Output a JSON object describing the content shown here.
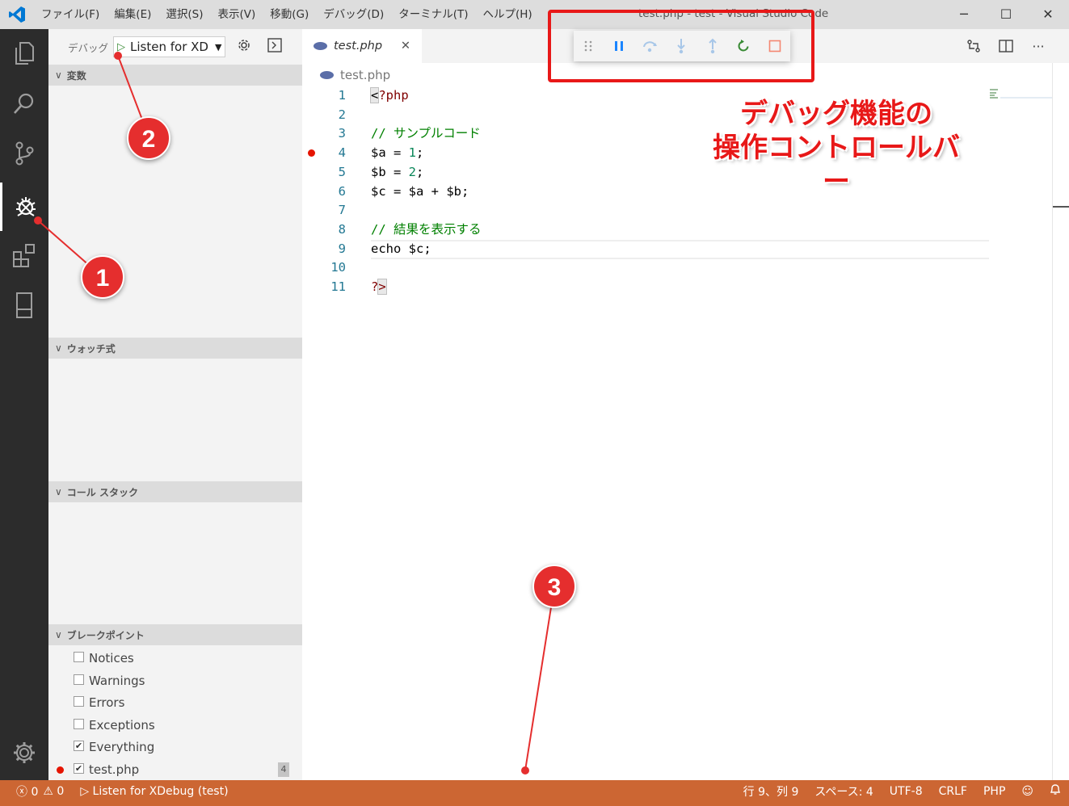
{
  "titlebar": {
    "menu": [
      "ファイル(F)",
      "編集(E)",
      "選択(S)",
      "表示(V)",
      "移動(G)",
      "デバッグ(D)",
      "ターミナル(T)",
      "ヘルプ(H)"
    ],
    "title": "test.php - test - Visual Studio Code",
    "controls": {
      "minimize": "─",
      "maximize": "☐",
      "close": "✕"
    }
  },
  "activity": {
    "items": [
      "explorer-icon",
      "search-icon",
      "source-control-icon",
      "debug-icon",
      "extensions-icon",
      "remote-icon"
    ],
    "active": "debug-icon",
    "settings": "gear-icon"
  },
  "sidebar": {
    "debug_label": "デバッグ",
    "config_name": "Listen for XD",
    "sections": {
      "variables": "変数",
      "watch": "ウォッチ式",
      "callstack": "コール スタック",
      "breakpoints": "ブレークポイント"
    },
    "breakpoints": [
      {
        "label": "Notices",
        "checked": false
      },
      {
        "label": "Warnings",
        "checked": false
      },
      {
        "label": "Errors",
        "checked": false
      },
      {
        "label": "Exceptions",
        "checked": false
      },
      {
        "label": "Everything",
        "checked": true
      },
      {
        "label": "test.php",
        "checked": true,
        "line": "4"
      }
    ]
  },
  "editor": {
    "tab_label": "test.php",
    "breadcrumb": "test.php",
    "lines": [
      {
        "n": "1",
        "text": "<?php"
      },
      {
        "n": "2",
        "text": ""
      },
      {
        "n": "3",
        "text": "// サンプルコード"
      },
      {
        "n": "4",
        "text": "$a = 1;"
      },
      {
        "n": "5",
        "text": "$b = 2;"
      },
      {
        "n": "6",
        "text": "$c = $a + $b;"
      },
      {
        "n": "7",
        "text": ""
      },
      {
        "n": "8",
        "text": "// 結果を表示する"
      },
      {
        "n": "9",
        "text": "echo $c;"
      },
      {
        "n": "10",
        "text": ""
      },
      {
        "n": "11",
        "text": "?>"
      }
    ],
    "breakpoint_line": "4"
  },
  "debug_toolbar": [
    "grip-icon",
    "pause-icon",
    "step-over-icon",
    "step-into-icon",
    "step-out-icon",
    "restart-icon",
    "stop-icon"
  ],
  "statusbar": {
    "errors": "0",
    "warnings": "0",
    "debug_session": "Listen for XDebug (test)",
    "position": "行 9、列 9",
    "spaces": "スペース: 4",
    "encoding": "UTF-8",
    "eol": "CRLF",
    "language": "PHP"
  },
  "annotations": {
    "callout_line1": "デバッグ機能の",
    "callout_line2": "操作コントロールバー",
    "markers": [
      "1",
      "2",
      "3"
    ]
  },
  "colors": {
    "statusbar": "#cc6633",
    "activity": "#2c2c2c",
    "annotation": "#e81818",
    "breakpoint": "#e51400"
  }
}
